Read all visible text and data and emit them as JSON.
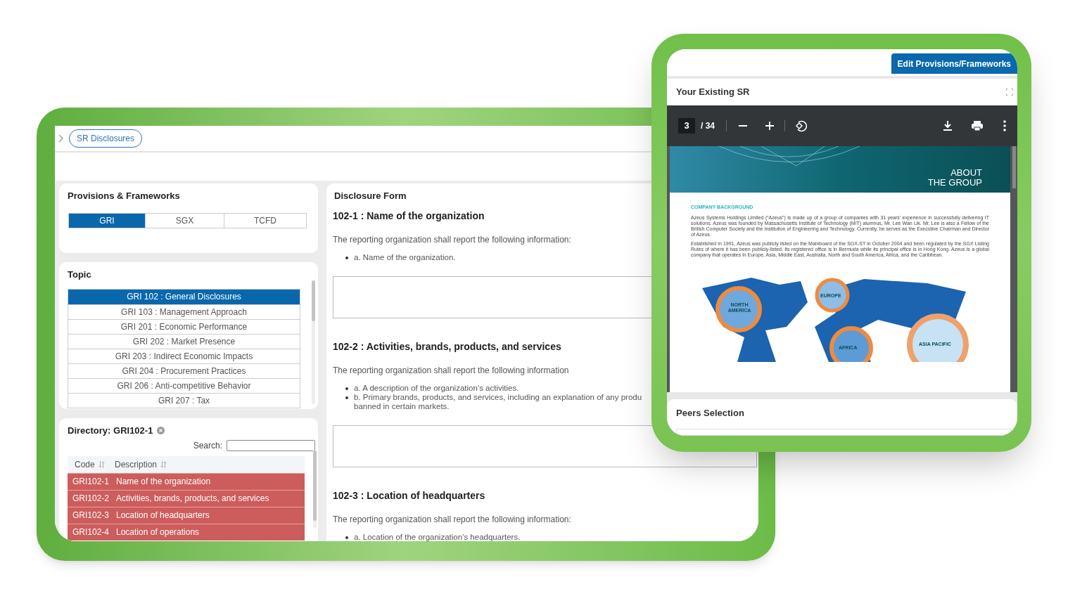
{
  "disclosures_window": {
    "breadcrumb": "SR Disclosures",
    "provisions": {
      "title": "Provisions & Frameworks",
      "tabs": [
        {
          "label": "GRI",
          "selected": true
        },
        {
          "label": "SGX",
          "selected": false
        },
        {
          "label": "TCFD",
          "selected": false
        }
      ]
    },
    "topic": {
      "title": "Topic",
      "items": [
        {
          "label": "GRI 102 : General Disclosures",
          "selected": true
        },
        {
          "label": "GRI 103 : Management Approach",
          "selected": false
        },
        {
          "label": "GRI 201 : Economic Performance",
          "selected": false
        },
        {
          "label": "GRI 202 : Market Presence",
          "selected": false
        },
        {
          "label": "GRI 203 : Indirect Economic Impacts",
          "selected": false
        },
        {
          "label": "GRI 204 : Procurement Practices",
          "selected": false
        },
        {
          "label": "GRI 206 : Anti-competitive Behavior",
          "selected": false
        },
        {
          "label": "GRI 207 : Tax",
          "selected": false
        }
      ]
    },
    "directory": {
      "title": "Directory: GRI102-1",
      "search_label": "Search:",
      "columns": [
        "Code",
        "Description"
      ],
      "rows": [
        {
          "code": "GRI102-1",
          "description": "Name of the organization"
        },
        {
          "code": "GRI102-2",
          "description": "Activities, brands, products, and services"
        },
        {
          "code": "GRI102-3",
          "description": "Location of headquarters"
        },
        {
          "code": "GRI102-4",
          "description": "Location of operations"
        }
      ]
    },
    "disclosure_form": {
      "title": "Disclosure Form",
      "sections": [
        {
          "heading": "102-1 : Name of the organization",
          "intro": "The reporting organization shall report the following information:",
          "bullets": [
            [
              "a. Name of the organization."
            ]
          ],
          "answer_box": true
        },
        {
          "heading": "102-2 : Activities, brands, products, and services",
          "intro": "The reporting organization shall report the following information",
          "bullets": [
            [
              "a. A description of the organization’s activities."
            ],
            [
              "b. Primary brands, products, and services, including an explanation of any produ",
              "banned in certain markets."
            ]
          ],
          "answer_box": true
        },
        {
          "heading": "102-3 : Location of headquarters",
          "intro": "The reporting organization shall report the following information:",
          "bullets": [
            [
              "a. Location of the organization’s headquarters."
            ]
          ],
          "answer_box": false
        }
      ]
    }
  },
  "sr_window": {
    "edit_button": "Edit Provisions/Frameworks",
    "viewer": {
      "title": "Your Existing SR",
      "page": "3",
      "page_count": "/ 34",
      "document": {
        "banner": [
          "ABOUT",
          "THE GROUP"
        ],
        "section_heading": "COMPANY BACKGROUND",
        "paragraphs": [
          "Azeus Systems Holdings Limited (“Azeus”) is made up of a group of companies with 31 years’ experience in successfully delivering IT solutions. Azeus was founded by Massachusetts Institute of Technology (MIT) alumnus, Mr. Lee Wan Lik. Mr. Lee is also a Fellow of the British Computer Society and the Institution of Engineering and Technology. Currently, he serves as the Executive Chairman and Director of Azeus.",
          "Established in 1991, Azeus was publicly listed on the Mainboard of the SGX-ST in October 2004 and been regulated by the SGX Listing Rules of where it has been publicly-listed. Its registered office is in Bermuda while its principal office is in Hong Kong. Azeus is a global company that operates in Europe, Asia, Middle East, Australia, North and South America, Africa, and the Caribbean."
        ],
        "map_labels": [
          "NORTH AMERICA",
          "EUROPE",
          "AFRICA",
          "ASIA PACIFIC"
        ]
      }
    },
    "peers": {
      "title": "Peers Selection"
    }
  }
}
